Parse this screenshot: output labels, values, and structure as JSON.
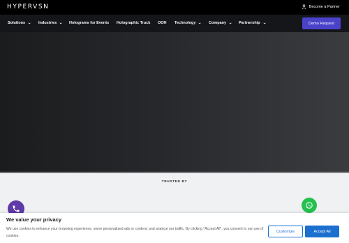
{
  "topbar": {
    "logo": "HYPERVSN",
    "partner_link": "Become a Partner"
  },
  "nav": {
    "items": [
      {
        "label": "Solutions",
        "dropdown": true
      },
      {
        "label": "Industries",
        "dropdown": true
      },
      {
        "label": "Holograms for Events",
        "dropdown": false
      },
      {
        "label": "Holographic Truck",
        "dropdown": false
      },
      {
        "label": "OOH",
        "dropdown": false
      },
      {
        "label": "Technology",
        "dropdown": true
      },
      {
        "label": "Company",
        "dropdown": true
      },
      {
        "label": "Partnership",
        "dropdown": true
      }
    ],
    "demo_button": "Demo Request"
  },
  "trusted": {
    "label": "TRUSTED BY"
  },
  "consent": {
    "title": "We value your privacy",
    "text": "We use cookies to enhance your browsing experience, serve personalized ads or content, and analyze our traffic. By clicking \"Accept All\", you consent to our use of cookies.",
    "customize_label": "Customize",
    "accept_label": "Accept All"
  },
  "colors": {
    "accent": "#4a42c9",
    "consent_blue": "#1b6fce",
    "whatsapp": "#25c14f",
    "call": "#5f3aa8"
  },
  "icons": {
    "partner": "user-icon",
    "call": "phone-icon",
    "chat": "whatsapp-icon",
    "dropdown": "chevron-down-icon"
  }
}
